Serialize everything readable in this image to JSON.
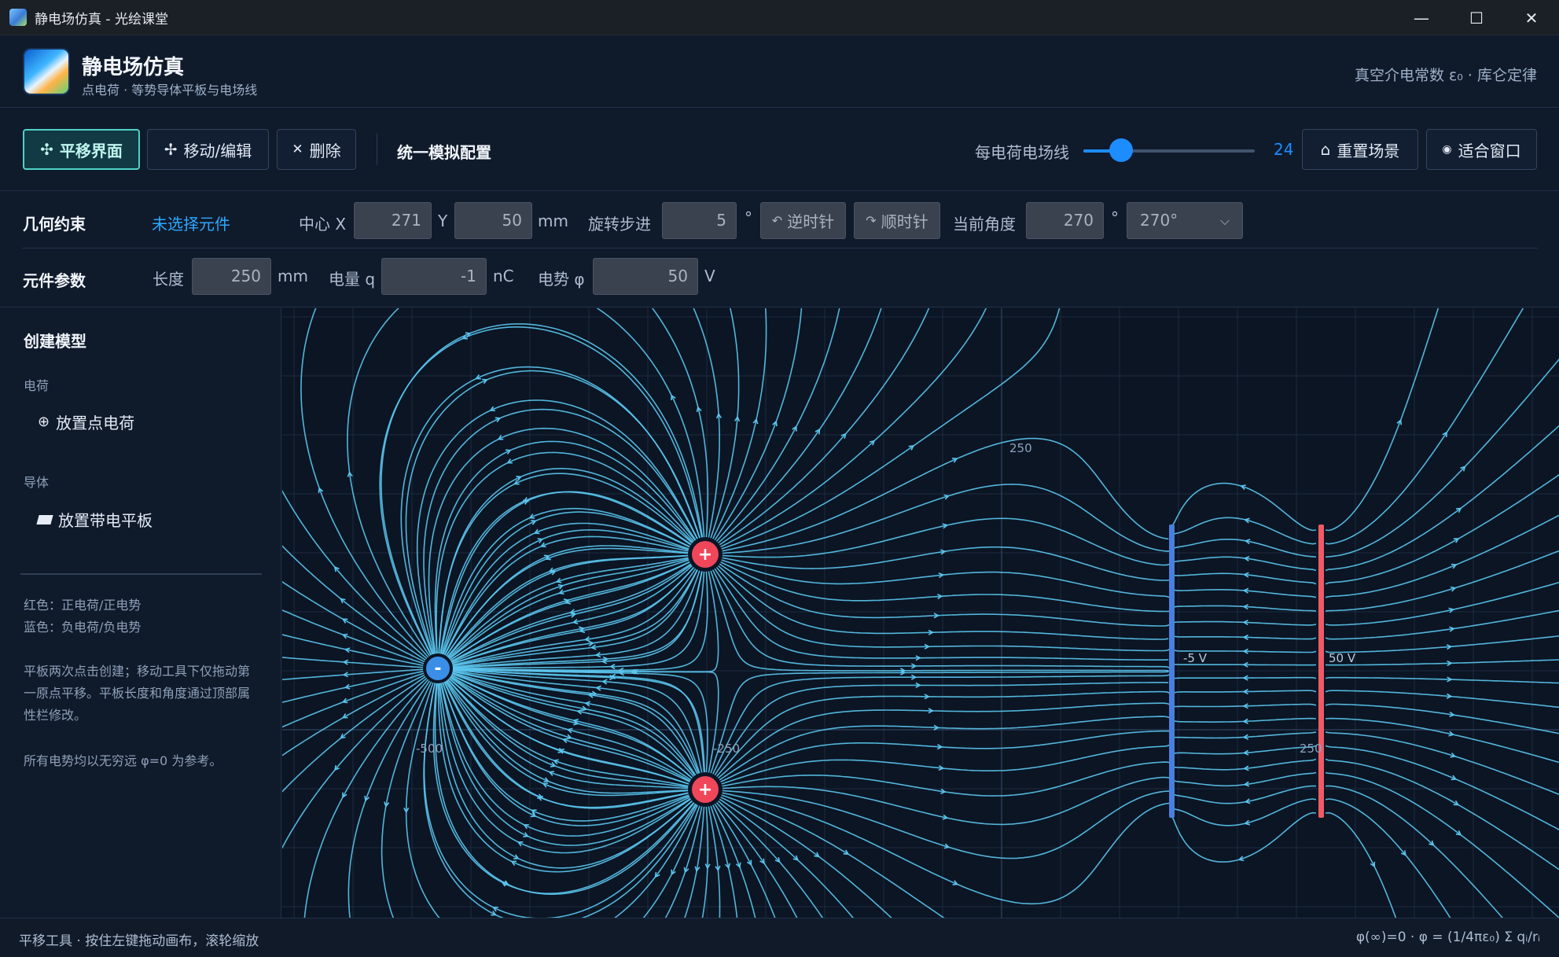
{
  "window": {
    "title": "静电场仿真 - 光绘课堂",
    "minimize": "—",
    "maximize": "☐",
    "close": "✕"
  },
  "header": {
    "app_title": "静电场仿真",
    "app_subtitle": "点电荷 · 等势导体平板与电场线",
    "right_text": "真空介电常数 ε₀ · 库仑定律"
  },
  "toolbar": {
    "pan_label": "平移界面",
    "move_label": "移动/编辑",
    "delete_label": "删除",
    "config_label": "统一模拟配置",
    "lines_label": "每电荷电场线",
    "lines_value": "24",
    "lines_fraction": 0.22,
    "reset_label": "重置场景",
    "fit_label": "适合窗口",
    "accent": "#1d8cff",
    "active_color": "#4fd1c5"
  },
  "geometry": {
    "heading": "几何约束",
    "selection": "未选择元件",
    "center_label": "中心 X",
    "center_x": "271",
    "y_label": "Y",
    "center_y": "50",
    "unit_mm": "mm",
    "step_label": "旋转步进",
    "step_value": "5",
    "deg": "°",
    "ccw_label": "逆时针",
    "cw_label": "顺时针",
    "angle_label": "当前角度",
    "angle_value": "270",
    "angle_deg": "°",
    "angle_select": "270°"
  },
  "params": {
    "heading": "元件参数",
    "length_label": "长度",
    "length_value": "250",
    "length_unit": "mm",
    "charge_label": "电量 q",
    "charge_value": "-1",
    "charge_unit": "nC",
    "potential_label": "电势 φ",
    "potential_value": "50",
    "potential_unit": "V"
  },
  "sidebar": {
    "heading": "创建模型",
    "charge_section": "电荷",
    "place_charge": "放置点电荷",
    "conductor_section": "导体",
    "place_plate": "放置带电平板",
    "note_red": "红色：正电荷/正电势",
    "note_blue": "蓝色：负电荷/负电势",
    "note_usage": "平板两次点击创建；移动工具下仅拖动第一原点平移。平板长度和角度通过顶部属性栏修改。",
    "note_ref": "所有电势均以无穷远 φ=0 为参考。"
  },
  "canvas": {
    "labels": {
      "y250": "250",
      "xm500": "-500",
      "xm250": "-250",
      "y_m250": "250",
      "plate_blue": "-5 V",
      "plate_red": "50 V"
    },
    "charges": [
      {
        "sign": "-",
        "color": "#3a8ee6"
      },
      {
        "sign": "+",
        "color": "#f0465a"
      },
      {
        "sign": "+",
        "color": "#f0465a"
      }
    ],
    "plates": [
      {
        "potential": "-5 V",
        "color": "#4a7fe0"
      },
      {
        "potential": "50 V",
        "color": "#f05a66"
      }
    ],
    "field_color": "#5bc6ef",
    "grid_color": "#1c2b40"
  },
  "status": {
    "left": "平移工具 · 按住左键拖动画布，滚轮缩放",
    "right": "φ(∞)=0 · φ = (1/4πε₀) Σ qᵢ/rᵢ"
  }
}
